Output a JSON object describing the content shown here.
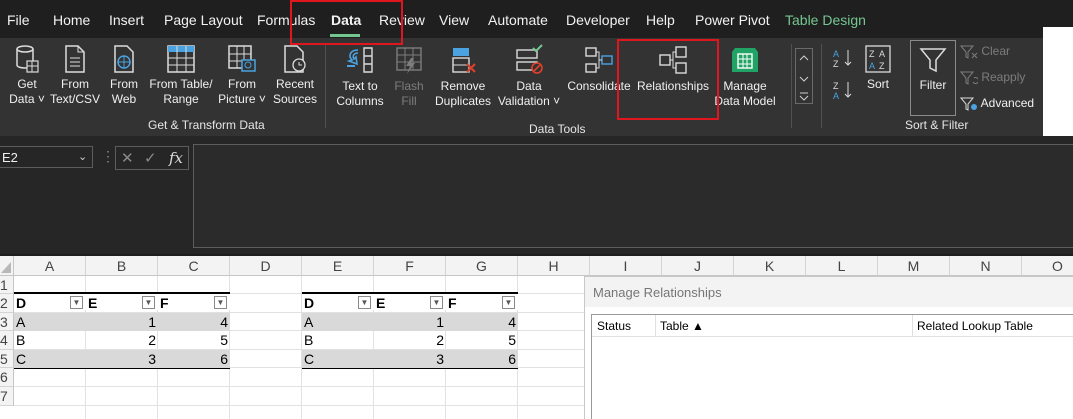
{
  "menu": {
    "file": "File",
    "home": "Home",
    "insert": "Insert",
    "page_layout": "Page Layout",
    "formulas": "Formulas",
    "data": "Data",
    "review": "Review",
    "view": "View",
    "automate": "Automate",
    "developer": "Developer",
    "help": "Help",
    "power_pivot": "Power Pivot",
    "table_design": "Table Design"
  },
  "ribbon": {
    "get_data": [
      "Get",
      "Data ˅"
    ],
    "from_text_csv": [
      "From",
      "Text/CSV"
    ],
    "from_web": [
      "From",
      "Web"
    ],
    "from_table_range": [
      "From Table/",
      "Range"
    ],
    "from_picture": [
      "From",
      "Picture ˅"
    ],
    "recent_sources": [
      "Recent",
      "Sources"
    ],
    "get_transform_label": "Get & Transform Data",
    "text_to_columns": [
      "Text to",
      "Columns"
    ],
    "flash_fill": [
      "Flash",
      "Fill"
    ],
    "remove_duplicates": [
      "Remove",
      "Duplicates"
    ],
    "data_validation": [
      "Data",
      "Validation ˅"
    ],
    "consolidate": "Consolidate",
    "relationships": "Relationships",
    "manage_data_model": [
      "Manage",
      "Data Model"
    ],
    "data_tools_label": "Data Tools",
    "sort": "Sort",
    "filter": "Filter",
    "clear": "Clear",
    "reapply": "Reapply",
    "advanced": "Advanced",
    "sort_filter_label": "Sort & Filter"
  },
  "formula_bar": {
    "name_box": "E2",
    "fx": "fx",
    "formula": ""
  },
  "grid": {
    "columns": [
      "A",
      "B",
      "C",
      "D",
      "E",
      "F",
      "G",
      "H",
      "I",
      "J",
      "K",
      "L",
      "M",
      "N",
      "O"
    ],
    "rows": [
      "1",
      "2",
      "3",
      "4",
      "5",
      "6",
      "7"
    ]
  },
  "table1": {
    "headers": [
      "D",
      "E",
      "F"
    ],
    "rows": [
      [
        "A",
        "1",
        "4"
      ],
      [
        "B",
        "2",
        "5"
      ],
      [
        "C",
        "3",
        "6"
      ]
    ]
  },
  "table2": {
    "headers": [
      "D",
      "E",
      "F"
    ],
    "rows": [
      [
        "A",
        "1",
        "4"
      ],
      [
        "B",
        "2",
        "5"
      ],
      [
        "C",
        "3",
        "6"
      ]
    ]
  },
  "dialog": {
    "title": "Manage Relationships",
    "columns": {
      "status": "Status",
      "table": "Table ▲",
      "related_lookup": "Related Lookup Table"
    }
  },
  "colors": {
    "accent_green": "#74c791",
    "highlight_red": "#e0161e",
    "ribbon_bg": "#333333"
  }
}
